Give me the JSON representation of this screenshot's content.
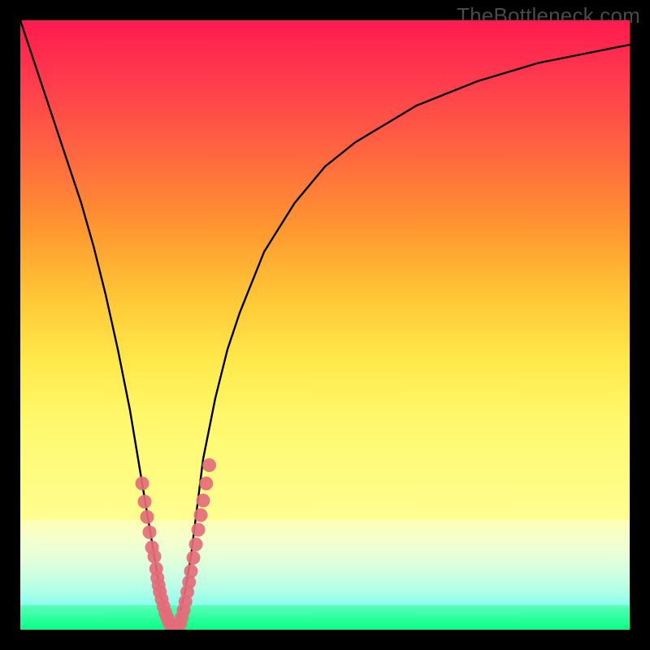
{
  "watermark": {
    "text": "TheBottleneck.com"
  },
  "colors": {
    "frame": "#000000",
    "curve_stroke": "#000000",
    "marker_fill": "#e46d7a",
    "marker_stroke": "#e46d7a"
  },
  "chart_data": {
    "type": "line",
    "title": "",
    "xlabel": "",
    "ylabel": "",
    "xlim": [
      0,
      100
    ],
    "ylim": [
      0,
      100
    ],
    "grid": false,
    "legend": false,
    "annotations": [
      "TheBottleneck.com"
    ],
    "series": [
      {
        "name": "bottleneck-curve",
        "x": [
          0,
          2,
          4,
          6,
          8,
          10,
          12,
          14,
          16,
          18,
          20,
          21,
          22,
          23,
          24,
          25,
          26,
          27,
          28,
          29,
          30,
          32,
          34,
          36,
          40,
          45,
          50,
          55,
          60,
          65,
          70,
          75,
          80,
          85,
          90,
          95,
          100
        ],
        "y": [
          100,
          94,
          88,
          82,
          76,
          70,
          63,
          55,
          46,
          36,
          24,
          18,
          12,
          6,
          2,
          0,
          2,
          6,
          12,
          20,
          28,
          38,
          46,
          52,
          62,
          70,
          76,
          80,
          83,
          86,
          88,
          90,
          91.5,
          93,
          94,
          95,
          96
        ]
      }
    ],
    "markers": {
      "name": "highlight-points",
      "shape": "circle",
      "color_hex": "#e46d7a",
      "points": [
        {
          "x": 20.0,
          "y": 24
        },
        {
          "x": 20.4,
          "y": 21
        },
        {
          "x": 20.8,
          "y": 18.5
        },
        {
          "x": 21.2,
          "y": 16
        },
        {
          "x": 21.6,
          "y": 13.5
        },
        {
          "x": 22.0,
          "y": 12
        },
        {
          "x": 22.3,
          "y": 10
        },
        {
          "x": 22.5,
          "y": 8.5
        },
        {
          "x": 22.7,
          "y": 7.3
        },
        {
          "x": 22.9,
          "y": 6.2
        },
        {
          "x": 23.2,
          "y": 5
        },
        {
          "x": 23.5,
          "y": 3.8
        },
        {
          "x": 23.8,
          "y": 2.8
        },
        {
          "x": 24.1,
          "y": 2
        },
        {
          "x": 24.4,
          "y": 1.3
        },
        {
          "x": 24.7,
          "y": 0.7
        },
        {
          "x": 25.0,
          "y": 0.3
        },
        {
          "x": 25.4,
          "y": 0.1
        },
        {
          "x": 25.8,
          "y": 0.3
        },
        {
          "x": 26.2,
          "y": 1.0
        },
        {
          "x": 26.5,
          "y": 2.0
        },
        {
          "x": 26.8,
          "y": 3.2
        },
        {
          "x": 27.1,
          "y": 4.6
        },
        {
          "x": 27.4,
          "y": 6.2
        },
        {
          "x": 27.7,
          "y": 7.8
        },
        {
          "x": 28.0,
          "y": 9.6
        },
        {
          "x": 28.4,
          "y": 11.8
        },
        {
          "x": 28.8,
          "y": 14.0
        },
        {
          "x": 29.2,
          "y": 16.4
        },
        {
          "x": 29.6,
          "y": 18.8
        },
        {
          "x": 30.0,
          "y": 21.2
        },
        {
          "x": 30.5,
          "y": 24.0
        },
        {
          "x": 31.0,
          "y": 27.0
        }
      ]
    }
  }
}
